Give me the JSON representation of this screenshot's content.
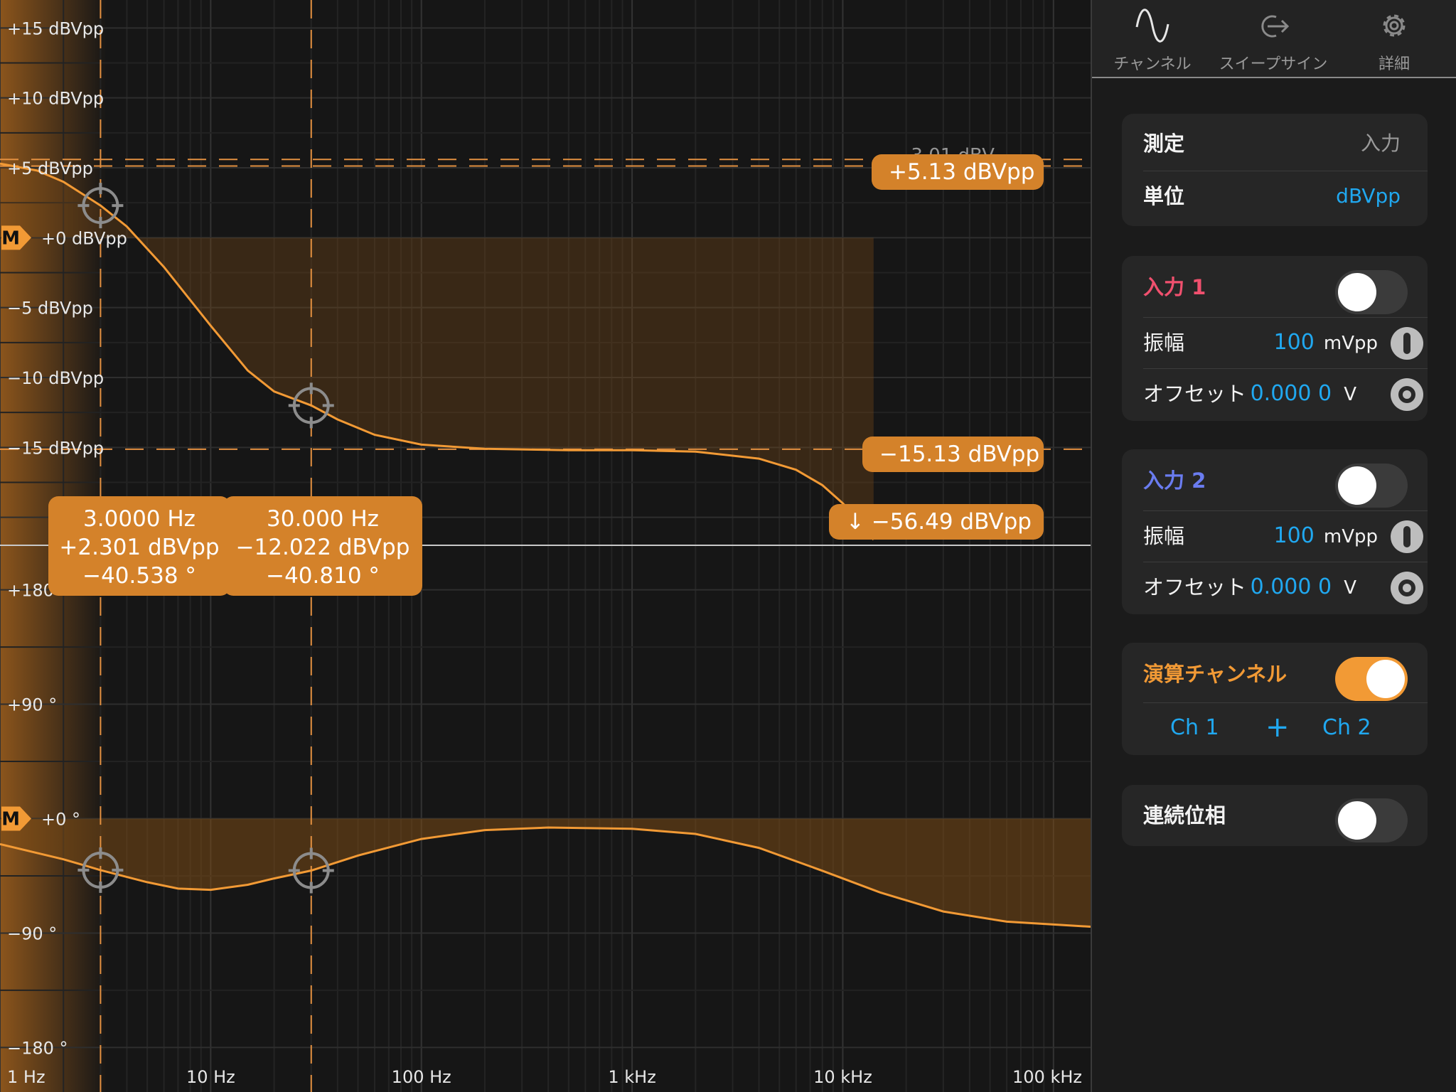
{
  "tabs": [
    {
      "label": "チャンネル",
      "icon": "sine-wave-icon"
    },
    {
      "label": "スイープサイン",
      "icon": "export-arrow-icon"
    },
    {
      "label": "詳細",
      "icon": "gear-icon"
    }
  ],
  "settings": {
    "measure_label": "測定",
    "measure_value": "入力",
    "unit_label": "単位",
    "unit_value": "dBVpp"
  },
  "input1": {
    "title": "入力 1",
    "enabled": false,
    "title_color": "#f0506e",
    "amplitude_label": "振幅",
    "amplitude_value": "100",
    "amplitude_unit": "mVpp",
    "offset_label": "オフセット",
    "offset_value": "0.000 0",
    "offset_unit": "V"
  },
  "input2": {
    "title": "入力 2",
    "enabled": false,
    "title_color": "#6a7cf0",
    "amplitude_label": "振幅",
    "amplitude_value": "100",
    "amplitude_unit": "mVpp",
    "offset_label": "オフセット",
    "offset_value": "0.000 0",
    "offset_unit": "V"
  },
  "math": {
    "title": "演算チャンネル",
    "enabled": true,
    "left": "Ch 1",
    "operator": "+",
    "right": "Ch 2"
  },
  "continuous_phase": {
    "label": "連続位相",
    "enabled": false
  },
  "tags": {
    "upper": "+5.13 dBVpp",
    "ghost": "-3.01 dBV",
    "lower": "−15.13 dBVpp",
    "min": "↓ −56.49 dBVpp"
  },
  "cursors": [
    {
      "freq": "3.0000 Hz",
      "mag": "+2.301 dBVpp",
      "phase": "−40.538 °"
    },
    {
      "freq": "30.000 Hz",
      "mag": "−12.022 dBVpp",
      "phase": "−40.810 °"
    }
  ],
  "marker_label": "M",
  "chart_data": [
    {
      "type": "line",
      "xlabel": "",
      "ylabel": "",
      "x_scale": "log",
      "xlim": [
        1,
        150000
      ],
      "ylim": [
        -22,
        17
      ],
      "x_ticks": [
        1,
        10,
        100,
        1000,
        10000,
        100000
      ],
      "x_tick_labels": [
        "1 Hz",
        "10 Hz",
        "100 Hz",
        "1 kHz",
        "10 kHz",
        "100 kHz"
      ],
      "y_ticks": [
        15,
        10,
        5,
        0,
        -5,
        -10,
        -15
      ],
      "y_tick_labels": [
        "+15 dBVpp",
        "+10 dBVpp",
        "+5 dBVpp",
        "+0 dBVpp",
        "−5 dBVpp",
        "−10 dBVpp",
        "−15 dBVpp"
      ],
      "series": [
        {
          "x": [
            1,
            1.5,
            2,
            3,
            4,
            6,
            10,
            15,
            20,
            30,
            40,
            60,
            100,
            200,
            500,
            1000,
            2000,
            4000,
            6000,
            8000,
            10000,
            12000,
            14000
          ],
          "y": [
            5.3,
            4.8,
            4.0,
            2.3,
            0.8,
            -2.1,
            -6.3,
            -9.5,
            -11.0,
            -12.0,
            -13.0,
            -14.1,
            -14.8,
            -15.1,
            -15.2,
            -15.2,
            -15.3,
            -15.8,
            -16.6,
            -17.7,
            -19.0,
            -20.3,
            -21.6
          ]
        }
      ],
      "cursor_x": [
        3,
        30
      ],
      "reference_lines_y": [
        5.13,
        -15.13,
        5.6
      ]
    },
    {
      "type": "line",
      "xlabel": "",
      "ylabel": "",
      "x_scale": "log",
      "xlim": [
        1,
        150000
      ],
      "ylim": [
        -215,
        215
      ],
      "y_ticks": [
        180,
        90,
        0,
        -90,
        -180
      ],
      "y_tick_labels": [
        "+180 °",
        "+90 °",
        "+0 °",
        "−90 °",
        "−180 °"
      ],
      "series": [
        {
          "x": [
            1,
            2,
            3,
            5,
            7,
            10,
            15,
            20,
            30,
            50,
            100,
            200,
            400,
            1000,
            2000,
            4000,
            8000,
            15000,
            30000,
            60000,
            150000
          ],
          "y": [
            -20,
            -32,
            -40.5,
            -50,
            -55,
            -56,
            -52,
            -47,
            -40.8,
            -29,
            -16,
            -9,
            -7,
            -8,
            -12,
            -23,
            -41,
            -58,
            -73,
            -81,
            -85
          ]
        }
      ],
      "cursor_x": [
        3,
        30
      ]
    }
  ]
}
